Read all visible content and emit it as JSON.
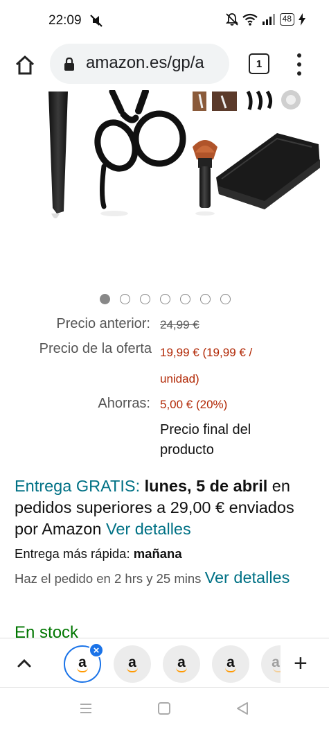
{
  "status_bar": {
    "time": "22:09",
    "battery": "48"
  },
  "browser": {
    "url": "amazon.es/gp/a",
    "tab_count": "1"
  },
  "gallery": {
    "dot_count": 7,
    "active_index": 0
  },
  "prices": {
    "previous_label": "Precio anterior:",
    "previous_value": "24,99 €",
    "offer_label": "Precio de la oferta",
    "offer_value_line1": "19,99 € (19,99 € /",
    "offer_value_line2": "unidad)",
    "savings_label": "Ahorras:",
    "savings_value": "5,00 € (20%)",
    "final_note": "Precio final del producto"
  },
  "delivery": {
    "free_label": "Entrega GRATIS:",
    "date": "lunes, 5 de abril",
    "condition": "en pedidos superiores a 29,00 € enviados por Amazon",
    "details_link": "Ver detalles",
    "fast_label": "Entrega más rápida:",
    "fast_value": "mañana",
    "order_by": "Haz el pedido en 2 hrs y 25 mins",
    "order_details_link": "Ver detalles",
    "stock": "En stock"
  },
  "tab_strip": {
    "tab_glyph": "a",
    "close_glyph": "×",
    "new_tab_glyph": "+"
  },
  "colors": {
    "price_red": "#b12704",
    "link_teal": "#007185",
    "stock_green": "#007600",
    "chrome_blue": "#1a73e8"
  }
}
